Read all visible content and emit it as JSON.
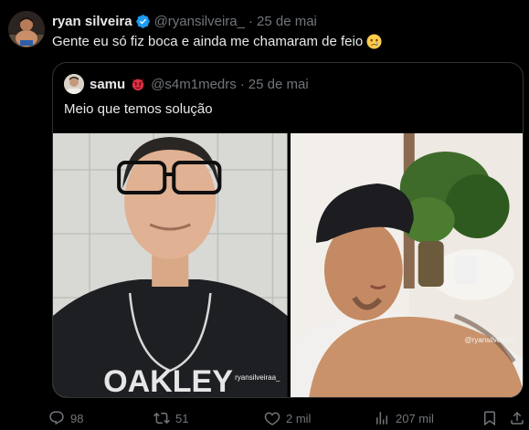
{
  "colors": {
    "background": "#000000",
    "text": "#e7e9ea",
    "secondary": "#71767b",
    "border": "#2f3336",
    "verified": "#1d9bf0"
  },
  "tweet": {
    "author_name": "ryan silveira",
    "handle": "@ryansilveira_",
    "separator": "·",
    "time": "25 de mai",
    "text": "Gente eu só fiz boca e ainda me chamaram de feio",
    "emoji_icon": "crying-face-icon"
  },
  "quote": {
    "author_name": "samu",
    "handle": "@s4m1medrs",
    "separator": "·",
    "time": "25 de mai",
    "text": "Meio que temos solução",
    "emoji_icon": "devil-face-icon",
    "photos": [
      {
        "watermark": "ryansilveiraa_"
      },
      {
        "watermark": "@ryansilveiraa_"
      }
    ]
  },
  "actions": {
    "replies": "98",
    "retweets": "51",
    "likes": "2 mil",
    "views": "207 mil"
  }
}
